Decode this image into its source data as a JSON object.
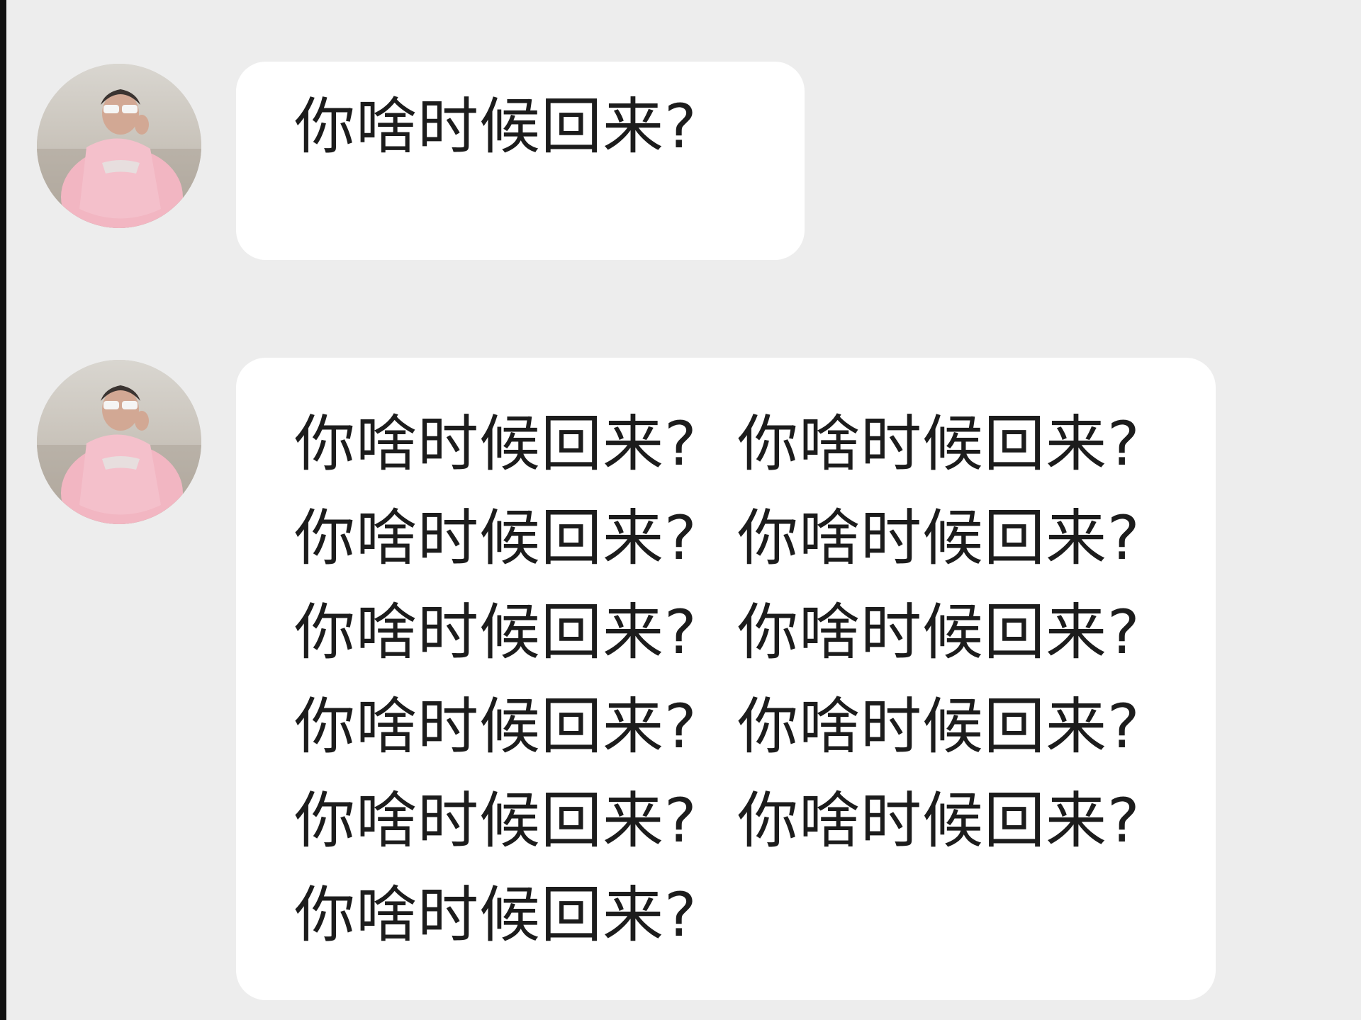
{
  "conversation": {
    "messages": [
      {
        "sender_avatar": "avatar-photo-person-in-pink",
        "text": "你啥时候回来?"
      },
      {
        "sender_avatar": "avatar-photo-person-in-pink",
        "lines": [
          [
            "你啥时候回来?",
            "你啥时候回来?"
          ],
          [
            "你啥时候回来?",
            "你啥时候回来?"
          ],
          [
            "你啥时候回来?",
            "你啥时候回来?"
          ],
          [
            "你啥时候回来?",
            "你啥时候回来?"
          ],
          [
            "你啥时候回来?",
            "你啥时候回来?"
          ],
          [
            "你啥时候回来?"
          ]
        ]
      }
    ]
  },
  "colors": {
    "background": "#ededed",
    "bubble": "#ffffff",
    "text": "#1c1c1c",
    "avatar_outfit": "#f2b6c2"
  }
}
